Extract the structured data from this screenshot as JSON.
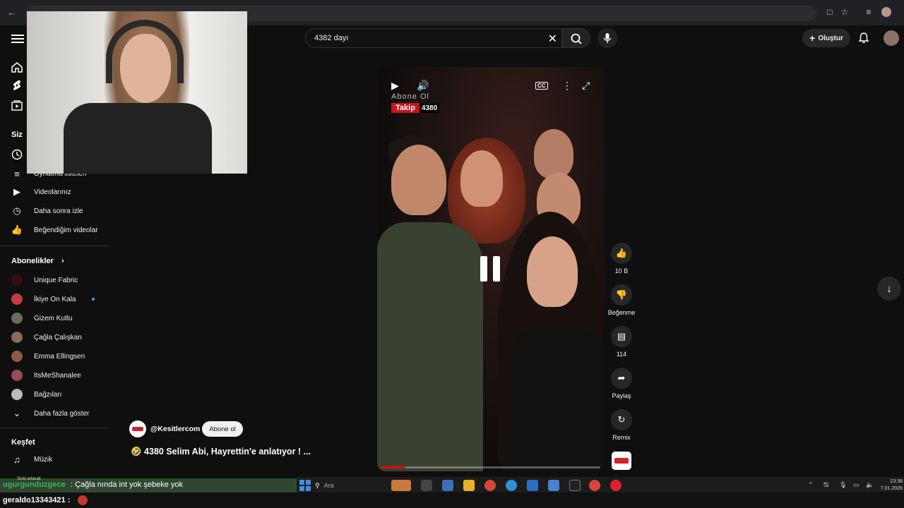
{
  "search": {
    "query": "4382 dayı"
  },
  "header": {
    "create_label": "Oluştur"
  },
  "sidebar": {
    "you_title": "Siz",
    "library_items": [
      {
        "label": "Videolarınız",
        "icon": "your-videos-icon"
      },
      {
        "label": "Daha sonra izle",
        "icon": "watch-later-icon"
      },
      {
        "label": "Beğendiğim videolar",
        "icon": "liked-videos-icon"
      }
    ],
    "partial_label": "Oynatma listeleri",
    "subscriptions_title": "Abonelikler",
    "subscriptions": [
      {
        "label": "Unique Fabric",
        "color": "#3a0d0d",
        "new": false
      },
      {
        "label": "İkiye On Kala",
        "color": "#c23b4a",
        "new": true
      },
      {
        "label": "Gizem Kutlu",
        "color": "#6b6b5a",
        "new": false
      },
      {
        "label": "Çağla Çalışkan",
        "color": "#8a6a5a",
        "new": false
      },
      {
        "label": "Emma Ellingsen",
        "color": "#8a5a4a",
        "new": false
      },
      {
        "label": "ItsMeShanalee",
        "color": "#9a4a5a",
        "new": false
      },
      {
        "label": "Bağzıları",
        "color": "#bbbbbb",
        "new": false
      }
    ],
    "show_more": "Daha fazla göster",
    "explore_title": "Keşfet",
    "explore_items": [
      {
        "label": "Müzik",
        "icon": "music-icon"
      }
    ]
  },
  "player": {
    "overlay_abone": "Abone Ol",
    "overlay_takip": "Takip",
    "overlay_count": "4380",
    "progress": 0.11
  },
  "actions": {
    "like_count": "10 B",
    "dislike_label": "Beğenme",
    "comment_count": "114",
    "share_label": "Paylaş",
    "remix_label": "Remix"
  },
  "video": {
    "channel": "@Kesitlercom",
    "subscribe_label": "Abone ol",
    "title": "🤣 4380 Selim Abi, Hayrettin'e anlatıyor ! ..."
  },
  "chat": {
    "line1_user": "ugurgunduzgece",
    "line1_msg": ": Çağla nında int yok şebeke yok",
    "line1_small": "Sicki artacak",
    "line2_user": "geraldo13343421 :"
  },
  "taskbar": {
    "search_placeholder": "Ara",
    "time": "23:38",
    "date": "7.01.2026"
  },
  "colors": {
    "accent": "#ff0000",
    "subscribe_bg": "#f1f1f1",
    "new_dot": "#3ea6ff"
  }
}
